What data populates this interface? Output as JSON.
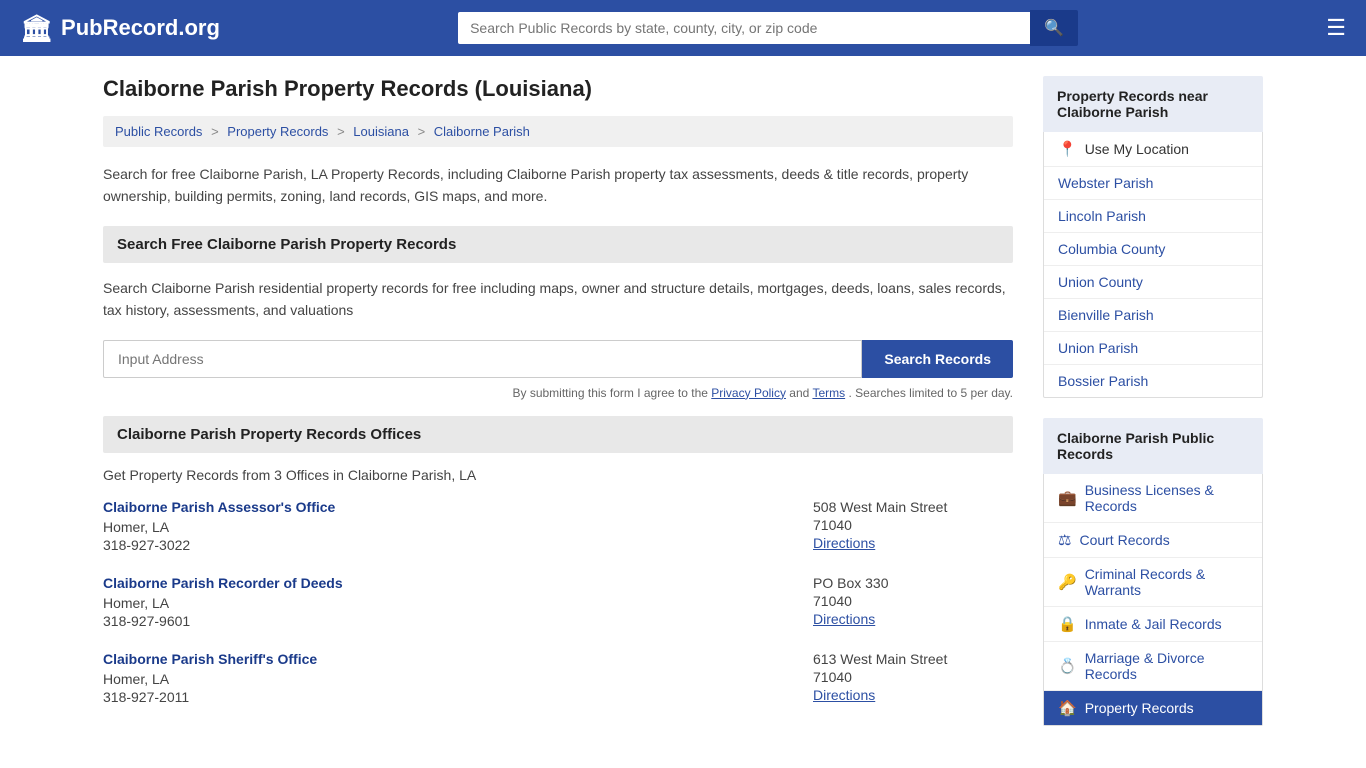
{
  "header": {
    "logo_icon": "🏛",
    "logo_text": "PubRecord.org",
    "search_placeholder": "Search Public Records by state, county, city, or zip code",
    "search_btn_icon": "🔍",
    "menu_icon": "☰"
  },
  "page": {
    "title": "Claiborne Parish Property Records (Louisiana)",
    "breadcrumbs": [
      {
        "label": "Public Records",
        "url": "#"
      },
      {
        "label": "Property Records",
        "url": "#"
      },
      {
        "label": "Louisiana",
        "url": "#"
      },
      {
        "label": "Claiborne Parish",
        "url": "#"
      }
    ],
    "description": "Search for free Claiborne Parish, LA Property Records, including Claiborne Parish property tax assessments, deeds & title records, property ownership, building permits, zoning, land records, GIS maps, and more.",
    "search_section_title": "Search Free Claiborne Parish Property Records",
    "search_description": "Search Claiborne Parish residential property records for free including maps, owner and structure details, mortgages, deeds, loans, sales records, tax history, assessments, and valuations",
    "search_placeholder": "Input Address",
    "search_button": "Search Records",
    "form_note": "By submitting this form I agree to the",
    "privacy_policy": "Privacy Policy",
    "and": "and",
    "terms": "Terms",
    "form_note_end": ". Searches limited to 5 per day.",
    "offices_section_title": "Claiborne Parish Property Records Offices",
    "offices_intro": "Get Property Records from 3 Offices in Claiborne Parish, LA",
    "offices": [
      {
        "name": "Claiborne Parish Assessor's Office",
        "city": "Homer, LA",
        "phone": "318-927-3022",
        "address": "508 West Main Street",
        "zip": "71040",
        "directions": "Directions"
      },
      {
        "name": "Claiborne Parish Recorder of Deeds",
        "city": "Homer, LA",
        "phone": "318-927-9601",
        "address": "PO Box 330",
        "zip": "71040",
        "directions": "Directions"
      },
      {
        "name": "Claiborne Parish Sheriff's Office",
        "city": "Homer, LA",
        "phone": "318-927-2011",
        "address": "613 West Main Street",
        "zip": "71040",
        "directions": "Directions"
      }
    ]
  },
  "sidebar": {
    "nearby_title": "Property Records near Claiborne Parish",
    "use_location": "Use My Location",
    "nearby_items": [
      {
        "label": "Webster Parish"
      },
      {
        "label": "Lincoln Parish"
      },
      {
        "label": "Columbia County"
      },
      {
        "label": "Union County"
      },
      {
        "label": "Bienville Parish"
      },
      {
        "label": "Union Parish"
      },
      {
        "label": "Bossier Parish"
      }
    ],
    "public_records_title": "Claiborne Parish Public Records",
    "public_records_items": [
      {
        "icon": "💼",
        "label": "Business Licenses & Records"
      },
      {
        "icon": "⚖",
        "label": "Court Records"
      },
      {
        "icon": "🔑",
        "label": "Criminal Records & Warrants"
      },
      {
        "icon": "🔒",
        "label": "Inmate & Jail Records"
      },
      {
        "icon": "💍",
        "label": "Marriage & Divorce Records"
      },
      {
        "icon": "🏠",
        "label": "Property Records",
        "active": true
      }
    ]
  }
}
